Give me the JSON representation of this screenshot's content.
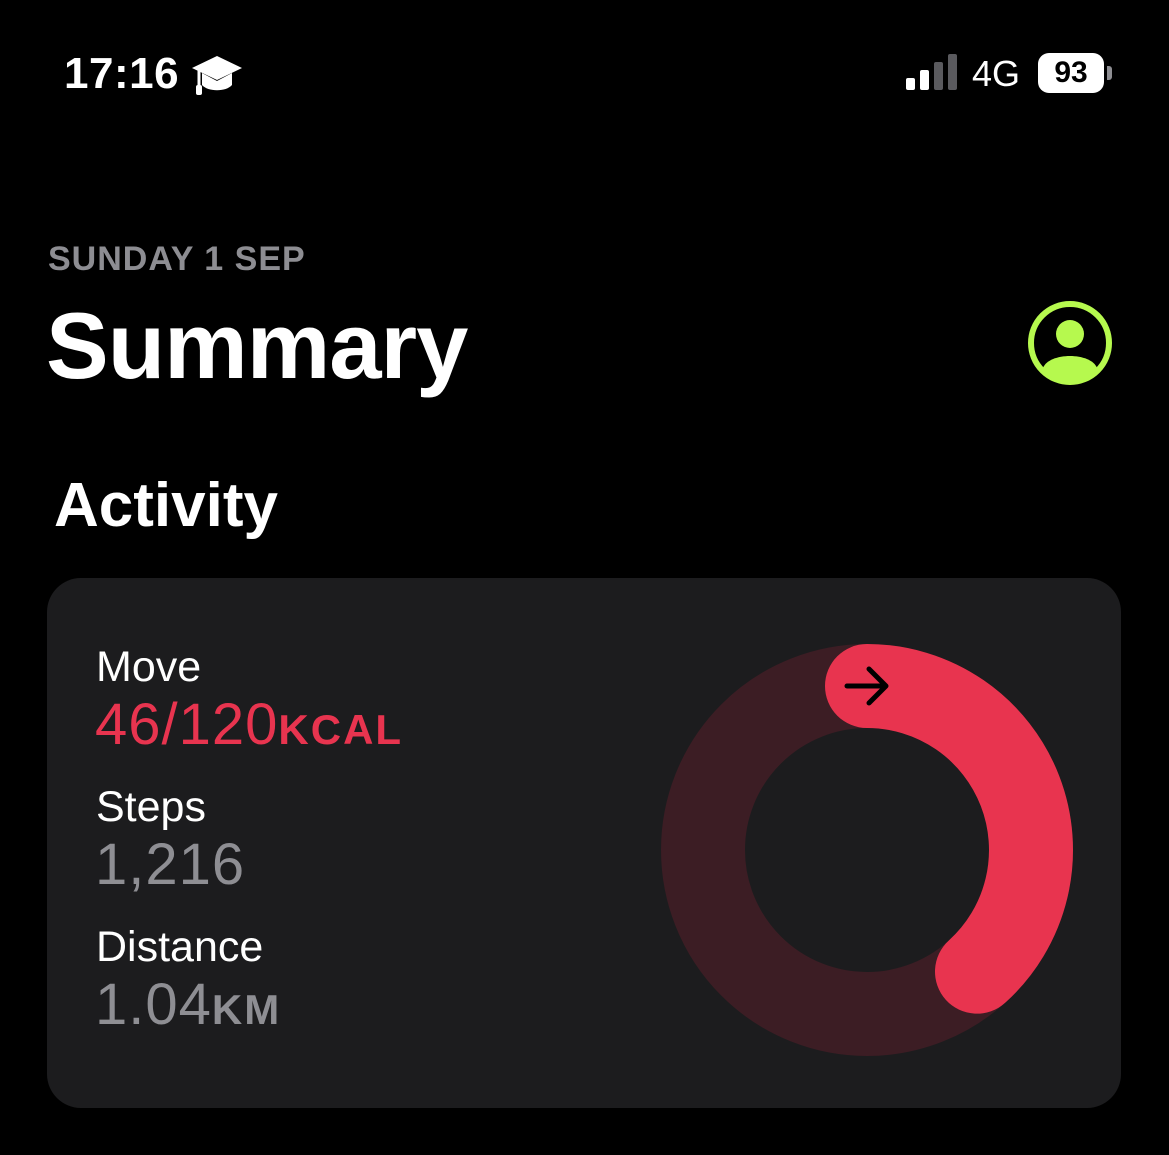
{
  "status_bar": {
    "time": "17:16",
    "status_icon": "graduation-cap-icon",
    "network": "4G",
    "battery": "93",
    "signal_bars_active": 2,
    "signal_bars_total": 4
  },
  "header": {
    "date": "SUNDAY 1 SEP",
    "title": "Summary",
    "profile_icon": "person-circle-icon"
  },
  "activity": {
    "section_title": "Activity",
    "move": {
      "label": "Move",
      "value": "46/120",
      "unit": "KCAL",
      "progress": 0.383
    },
    "steps": {
      "label": "Steps",
      "value": "1,216"
    },
    "distance": {
      "label": "Distance",
      "value": "1.04",
      "unit": "KM"
    },
    "ring_arrow_icon": "arrow-right-icon"
  },
  "colors": {
    "background": "#000000",
    "card": "#1c1c1e",
    "move_red": "#e8344f",
    "move_track": "#3c1d24",
    "profile_green": "#b6f94e",
    "secondary_text": "#8d8d92"
  }
}
